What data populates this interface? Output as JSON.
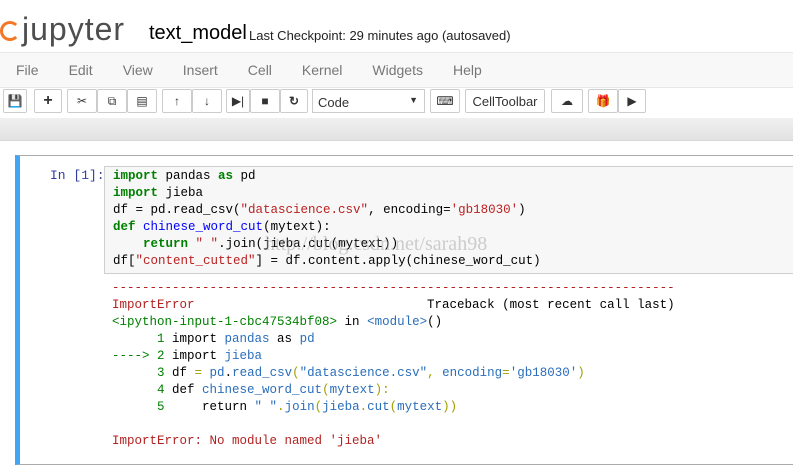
{
  "header": {
    "logo": "jupyter",
    "notebook_name": "text_model",
    "checkpoint": "Last Checkpoint: 29 minutes ago (autosaved)"
  },
  "menu": [
    "File",
    "Edit",
    "View",
    "Insert",
    "Cell",
    "Kernel",
    "Widgets",
    "Help"
  ],
  "toolbar": {
    "cell_type": "Code",
    "celltoolbar": "CellToolbar"
  },
  "cell": {
    "prompt": "In [1]:",
    "input": [
      [
        [
          "import",
          "kw"
        ],
        [
          " pandas ",
          ""
        ],
        [
          "as",
          "kw"
        ],
        [
          " pd",
          ""
        ]
      ],
      [
        [
          "import",
          "kw"
        ],
        [
          " jieba",
          ""
        ]
      ],
      [
        [
          "df = pd.read_csv(",
          ""
        ],
        [
          "\"datascience.csv\"",
          "st"
        ],
        [
          ", encoding=",
          ""
        ],
        [
          "'gb18030'",
          "st"
        ],
        [
          ")",
          ""
        ]
      ],
      [
        [
          "def",
          "kw"
        ],
        [
          " ",
          ""
        ],
        [
          "chinese_word_cut",
          "fn"
        ],
        [
          "(mytext):",
          ""
        ]
      ],
      [
        [
          "    ",
          ""
        ],
        [
          "return",
          "kw"
        ],
        [
          " ",
          ""
        ],
        [
          "\" \"",
          "st"
        ],
        [
          ".join(jieba.cut(mytext))",
          ""
        ]
      ],
      [
        [
          "df[",
          ""
        ],
        [
          "\"content_cutted\"",
          "st"
        ],
        [
          "] = df.content.apply(chinese_word_cut)",
          ""
        ]
      ]
    ],
    "output": [
      [
        [
          "---------------------------------------------------------------------------",
          "er"
        ]
      ],
      [
        [
          "ImportError",
          "er"
        ],
        [
          "                               Traceback (most recent call last)",
          ""
        ]
      ],
      [
        [
          "<ipython-input-1-cbc47534bf08>",
          "tg"
        ],
        [
          " in ",
          ""
        ],
        [
          "<module>",
          "tb2"
        ],
        [
          "()",
          ""
        ]
      ],
      [
        [
          "      1 ",
          "tg"
        ],
        [
          "import ",
          ""
        ],
        [
          "pandas ",
          "tb2"
        ],
        [
          "as ",
          ""
        ],
        [
          "pd",
          "tb2"
        ]
      ],
      [
        [
          "----> 2 ",
          "tg"
        ],
        [
          "import ",
          ""
        ],
        [
          "jieba",
          "tb2"
        ]
      ],
      [
        [
          "      3 ",
          "tg"
        ],
        [
          "df ",
          ""
        ],
        [
          "= ",
          "ty"
        ],
        [
          "pd",
          "tb2"
        ],
        [
          ".",
          ""
        ],
        [
          "read_csv",
          "tb2"
        ],
        [
          "(",
          "ty"
        ],
        [
          "\"datascience.csv\"",
          "tb2"
        ],
        [
          ", ",
          "ty"
        ],
        [
          "encoding",
          "tb2"
        ],
        [
          "=",
          "ty"
        ],
        [
          "'gb18030'",
          "tb2"
        ],
        [
          ")",
          "ty"
        ]
      ],
      [
        [
          "      4 ",
          "tg"
        ],
        [
          "def ",
          ""
        ],
        [
          "chinese_word_cut",
          "tb2"
        ],
        [
          "(",
          "ty"
        ],
        [
          "mytext",
          "tb2"
        ],
        [
          "):",
          "ty"
        ]
      ],
      [
        [
          "      5 ",
          "tg"
        ],
        [
          "    return ",
          ""
        ],
        [
          "\" \"",
          "tb2"
        ],
        [
          ".",
          "ty"
        ],
        [
          "join",
          "tb2"
        ],
        [
          "(",
          "ty"
        ],
        [
          "jieba",
          "tb2"
        ],
        [
          ".",
          "ty"
        ],
        [
          "cut",
          "tb2"
        ],
        [
          "(",
          "ty"
        ],
        [
          "mytext",
          "tb2"
        ],
        [
          "))",
          "ty"
        ]
      ],
      [
        [
          "",
          ""
        ]
      ],
      [
        [
          "ImportError",
          "er"
        ],
        [
          ": No module named ",
          "er"
        ],
        [
          "'jieba'",
          "er"
        ]
      ]
    ]
  },
  "watermark": "http://blog.csdn.net/sarah98"
}
